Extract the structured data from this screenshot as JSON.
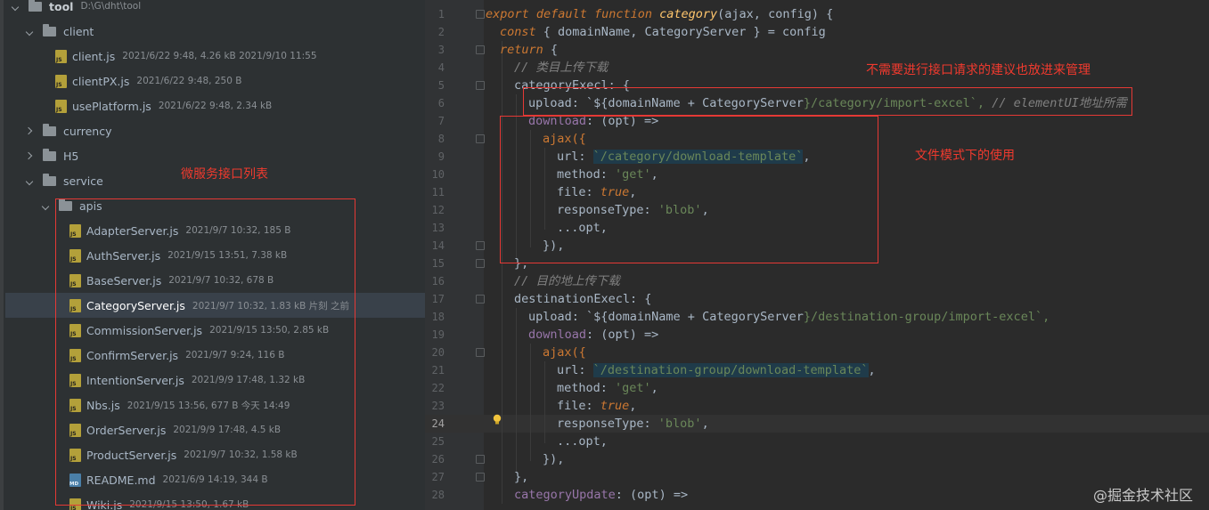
{
  "project_tree": {
    "root": {
      "name": "tool",
      "path": "D:\\G\\dht\\tool"
    },
    "client_folder": "client",
    "client_files": [
      {
        "name": "client.js",
        "meta": "2021/6/22 9:48, 4.26 kB 2021/9/10 11:55"
      },
      {
        "name": "clientPX.js",
        "meta": "2021/6/22 9:48, 250 B"
      },
      {
        "name": "usePlatform.js",
        "meta": "2021/6/22 9:48, 2.34 kB"
      }
    ],
    "folders": [
      "currency",
      "H5",
      "service"
    ],
    "apis_folder": "apis",
    "api_files": [
      {
        "name": "AdapterServer.js",
        "meta": "2021/9/7 10:32, 185 B"
      },
      {
        "name": "AuthServer.js",
        "meta": "2021/9/15 13:51, 7.38 kB"
      },
      {
        "name": "BaseServer.js",
        "meta": "2021/9/7 10:32, 678 B"
      },
      {
        "name": "CategoryServer.js",
        "meta": "2021/9/7 10:32, 1.83 kB 片刻 之前"
      },
      {
        "name": "CommissionServer.js",
        "meta": "2021/9/15 13:50, 2.85 kB"
      },
      {
        "name": "ConfirmServer.js",
        "meta": "2021/9/7 9:24, 116 B"
      },
      {
        "name": "IntentionServer.js",
        "meta": "2021/9/9 17:48, 1.32 kB"
      },
      {
        "name": "Nbs.js",
        "meta": "2021/9/15 13:56, 677 B 今天 14:49"
      },
      {
        "name": "OrderServer.js",
        "meta": "2021/9/9 17:48, 4.5 kB"
      },
      {
        "name": "ProductServer.js",
        "meta": "2021/9/7 10:32, 1.58 kB"
      },
      {
        "name": "README.md",
        "meta": "2021/6/9 14:19, 344 B"
      },
      {
        "name": "Wiki.js",
        "meta": "2021/9/15 13:50, 1.67 kB"
      }
    ],
    "selected_file": "CategoryServer.js"
  },
  "annotations": {
    "microservice_list": "微服务接口列表",
    "no_request_note": "不需要进行接口请求的建议也放进来管理",
    "file_mode_note": "文件模式下的使用"
  },
  "editor": {
    "line_numbers": [
      "1",
      "2",
      "3",
      "4",
      "5",
      "6",
      "7",
      "8",
      "9",
      "10",
      "11",
      "12",
      "13",
      "14",
      "15",
      "16",
      "17",
      "18",
      "19",
      "20",
      "21",
      "22",
      "23",
      "24",
      "25",
      "26",
      "27",
      "28"
    ],
    "current_line": "24",
    "line1": {
      "export": "export",
      "default": "default",
      "function": "function",
      "name": "category",
      "rest": "(ajax, config) {"
    },
    "line2": {
      "const": "const",
      "rest": " { domainName, CategoryServer } = config"
    },
    "line3": {
      "return": "return",
      "rest": " {"
    },
    "line4": "// 类目上传下载",
    "line5": "categoryExecl: {",
    "line6": {
      "a": "upload: `${",
      "b": "domainName + CategoryServer",
      "c": "}/category/import-excel`,",
      "cmt": " // elementUI地址所需"
    },
    "line7": {
      "prop": "download",
      "rest": ": (opt) =>"
    },
    "line8": "ajax({",
    "line9": {
      "a": "url: ",
      "str": "`/category/download-template`",
      "b": ","
    },
    "line10": {
      "a": "method: ",
      "str": "'get'",
      "b": ","
    },
    "line11": {
      "a": "file: ",
      "kw": "true",
      "b": ","
    },
    "line12": {
      "a": "responseType: ",
      "str": "'blob'",
      "b": ","
    },
    "line13": {
      "a": "...opt",
      "b": ","
    },
    "line14": "}),",
    "line15": "},",
    "line16": "// 目的地上传下载",
    "line17": "destinationExecl: {",
    "line18": {
      "a": "upload: `${",
      "b": "domainName + CategoryServer",
      "c": "}/destination-group/import-excel`,"
    },
    "line19": {
      "prop": "download",
      "rest": ": (opt) =>"
    },
    "line20": "ajax({",
    "line21": {
      "a": "url: ",
      "str": "`/destination-group/download-template`",
      "b": ","
    },
    "line22": {
      "a": "method: ",
      "str": "'get'",
      "b": ","
    },
    "line23": {
      "a": "file: ",
      "kw": "true",
      "b": ","
    },
    "line24": {
      "a": "responseType: ",
      "str": "'blob'",
      "b": ","
    },
    "line25": {
      "a": "...opt",
      "b": ","
    },
    "line26": "}),",
    "line27": "},",
    "line28": {
      "prop": "categoryUpdate",
      "rest": ": (opt) =>"
    }
  },
  "watermark": "@掘金技术社区",
  "colors": {
    "annotation_red": "#e53935",
    "keyword": "#cc7832",
    "string": "#6a8759",
    "property": "#9876aa"
  }
}
